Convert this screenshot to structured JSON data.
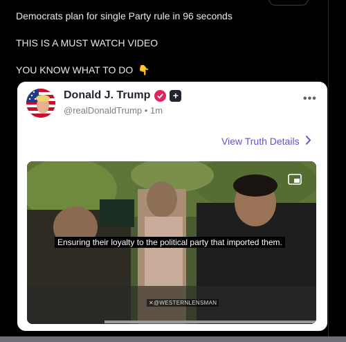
{
  "tweet": {
    "line1": "Democrats plan for single Party rule in 96 seconds",
    "line2": "THIS IS A MUST WATCH VIDEO",
    "line3": "YOU KNOW WHAT TO DO",
    "line3_emoji": "👇"
  },
  "embed": {
    "author_name": "Donald J. Trump",
    "verified_icon": "verified-badge-icon",
    "follow_icon": "plus-icon",
    "handle": "@realDonaldTrump",
    "separator": "•",
    "time": "1m",
    "more_icon": "more-horizontal-icon",
    "view_details_label": "View Truth Details",
    "chevron_icon": "chevron-right-icon",
    "accent_color": "#5b52cc",
    "badge_color": "#e0245e"
  },
  "video": {
    "caption": "Ensuring their loyalty to the political party that imported them.",
    "watermark": "✕@WESTERNLENSMAN",
    "pip_icon": "picture-in-picture-icon"
  }
}
